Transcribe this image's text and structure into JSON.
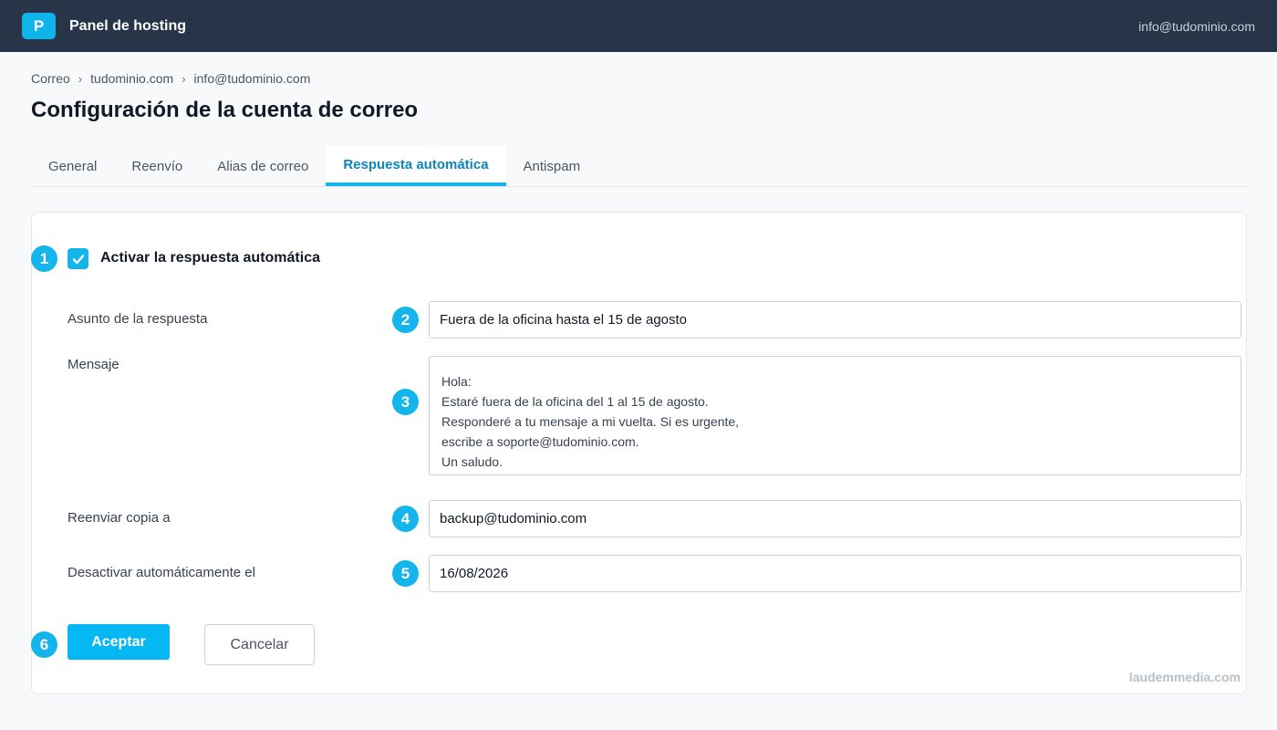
{
  "header": {
    "logo_letter": "P",
    "app_name": "Panel de hosting",
    "user_email": "info@tudominio.com"
  },
  "breadcrumb": {
    "items": [
      "Correo",
      "tudominio.com",
      "info@tudominio.com"
    ],
    "separator": "›"
  },
  "page_title": "Configuración de la cuenta de correo",
  "tabs": [
    {
      "label": "General",
      "active": false
    },
    {
      "label": "Reenvío",
      "active": false
    },
    {
      "label": "Alias de correo",
      "active": false
    },
    {
      "label": "Respuesta automática",
      "active": true
    },
    {
      "label": "Antispam",
      "active": false
    }
  ],
  "form": {
    "enable_autoreply": {
      "label": "Activar la respuesta automática",
      "checked": true
    },
    "subject": {
      "label": "Asunto de la respuesta",
      "value": "Fuera de la oficina hasta el 15 de agosto"
    },
    "message": {
      "label": "Mensaje",
      "value": "Hola:\nEstaré fuera de la oficina del 1 al 15 de agosto.\nResponderé a tu mensaje a mi vuelta. Si es urgente,\nescribe a soporte@tudominio.com.\nUn saludo."
    },
    "forward_copy": {
      "label": "Reenviar copia a",
      "value": "backup@tudominio.com"
    },
    "auto_disable": {
      "label": "Desactivar automáticamente el",
      "value": "16/08/2026"
    },
    "accept_label": "Aceptar",
    "cancel_label": "Cancelar"
  },
  "step_badges": [
    "1",
    "2",
    "3",
    "4",
    "5",
    "6"
  ],
  "watermark": "laudemmedia.com",
  "colors": {
    "topbar": "#283548",
    "accent": "#13b5ea",
    "active_tab_text": "#0b86b8"
  }
}
